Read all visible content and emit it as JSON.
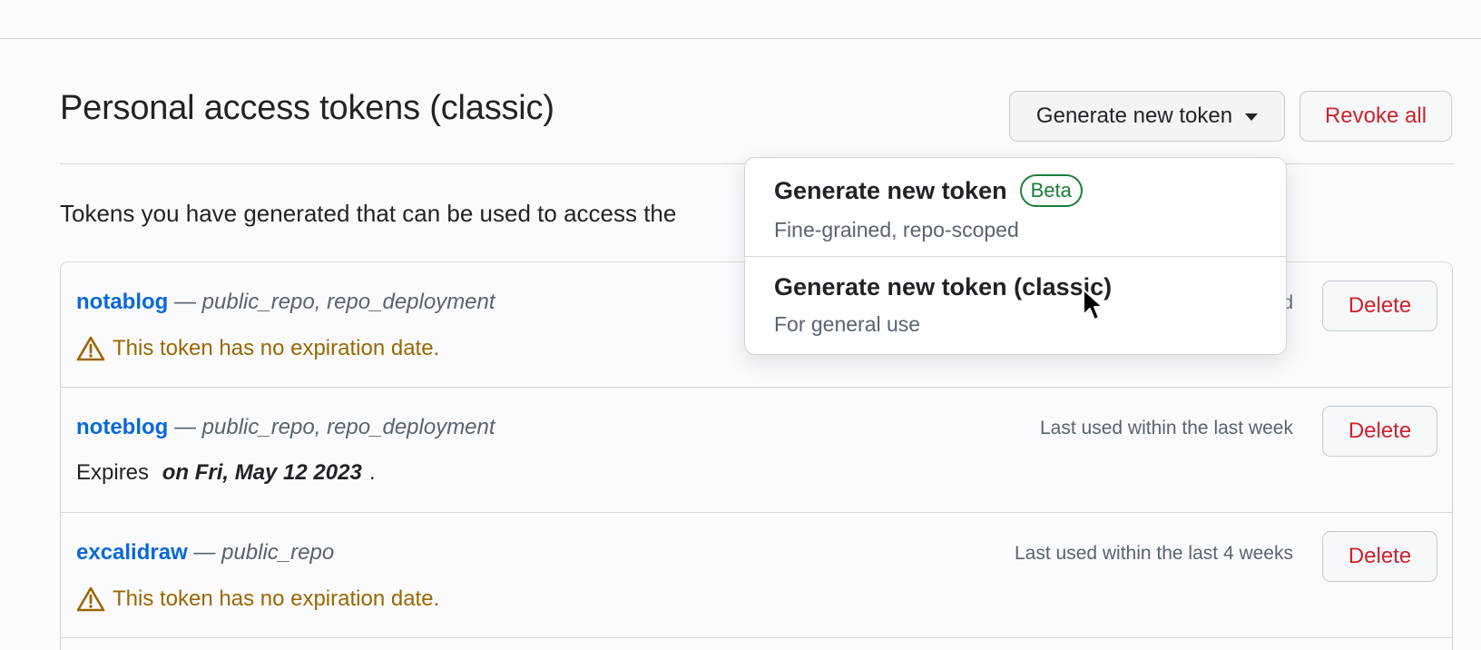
{
  "header": {
    "title": "Personal access tokens (classic)",
    "generate_label": "Generate new token",
    "revoke_label": "Revoke all"
  },
  "intro": "Tokens you have generated that can be used to access the",
  "dropdown": {
    "items": [
      {
        "title": "Generate new token",
        "badge": "Beta",
        "description": "Fine-grained, repo-scoped"
      },
      {
        "title": "Generate new token (classic)",
        "description": "For general use"
      }
    ]
  },
  "tokens": [
    {
      "name": "notablog",
      "separator": "—",
      "scopes": "public_repo, repo_deployment",
      "last_used": "d",
      "note": "This token has no expiration date.",
      "delete_label": "Delete"
    },
    {
      "name": "noteblog",
      "separator": "—",
      "scopes": "public_repo, repo_deployment",
      "last_used": "Last used within the last week",
      "expires_prefix": "Expires ",
      "expires_date": "on Fri, May 12 2023",
      "expires_suffix": ".",
      "delete_label": "Delete"
    },
    {
      "name": "excalidraw",
      "separator": "—",
      "scopes": "public_repo",
      "last_used": "Last used within the last 4 weeks",
      "note": "This token has no expiration date.",
      "delete_label": "Delete"
    }
  ],
  "icons": {
    "warning": "alert-triangle-icon",
    "caret": "triangle-down-icon",
    "cursor": "mouse-pointer-icon"
  },
  "colors": {
    "link": "#0969da",
    "danger": "#cf222e",
    "warning": "#9a6700",
    "success": "#1a7f37"
  }
}
